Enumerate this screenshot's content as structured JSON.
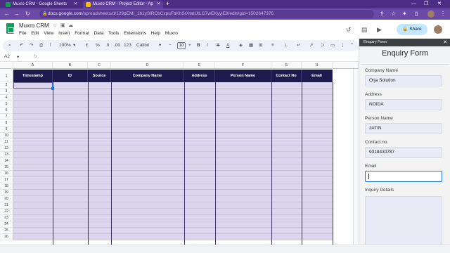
{
  "browser": {
    "tabs": [
      {
        "title": "Muxro CRM - Google Sheets",
        "active": false
      },
      {
        "title": "Muxro CRM - Project Editor - Ap",
        "active": true
      }
    ],
    "url_host": "docs.google.com",
    "url_path": "/spreadsheets/d/129pEMI_1b1ySlRCbCxpuFbKhSrXtatUtLG7wEKyyjE8/edit#gid=1502647376"
  },
  "app": {
    "title": "Muxro CRM",
    "menu": [
      "File",
      "Edit",
      "View",
      "Insert",
      "Format",
      "Data",
      "Tools",
      "Extensions",
      "Help",
      "Muxro"
    ],
    "share_label": "Share"
  },
  "toolbar": {
    "zoom": "100%",
    "currency": "£",
    "percent": "%",
    "dec_less": ".0",
    "dec_more": ".00",
    "number_format": "123",
    "font": "Calibri",
    "font_size": "10",
    "bold": "B",
    "italic": "I",
    "strike": "S",
    "text_color": "A"
  },
  "formula_bar": {
    "cell_ref": "A2",
    "fx": "fx",
    "value": ""
  },
  "sheet": {
    "col_letters": [
      "A",
      "B",
      "C",
      "D",
      "E",
      "F",
      "G",
      "H"
    ],
    "headers": [
      "Timestamp",
      "ID",
      "Source",
      "Company Name",
      "Address",
      "Person Name",
      "Contact No",
      "Email"
    ],
    "row_numbers": [
      "1",
      "2",
      "3",
      "4",
      "5",
      "6",
      "7",
      "8",
      "9",
      "10",
      "11",
      "12",
      "13",
      "14",
      "15",
      "16",
      "17",
      "18",
      "19",
      "20",
      "21",
      "22",
      "23",
      "24",
      "25",
      "26"
    ]
  },
  "enquiry_form": {
    "panel_title": "Enquiry Form",
    "heading": "Enquiry Form",
    "fields": [
      {
        "label": "Company Name",
        "value": "Orja Solution"
      },
      {
        "label": "Address",
        "value": "NOIDA"
      },
      {
        "label": "Person Name",
        "value": "JATIN"
      },
      {
        "label": "Contact no.",
        "value": "9318430787"
      },
      {
        "label": "Email",
        "value": ""
      }
    ],
    "details_label": "Inquiry Details"
  },
  "colors": {
    "chrome_purple": "#4b2e83",
    "header_navy": "#1f1a4d",
    "row_lavender": "#dcd6ec",
    "accent_blue": "#1a73e8"
  }
}
